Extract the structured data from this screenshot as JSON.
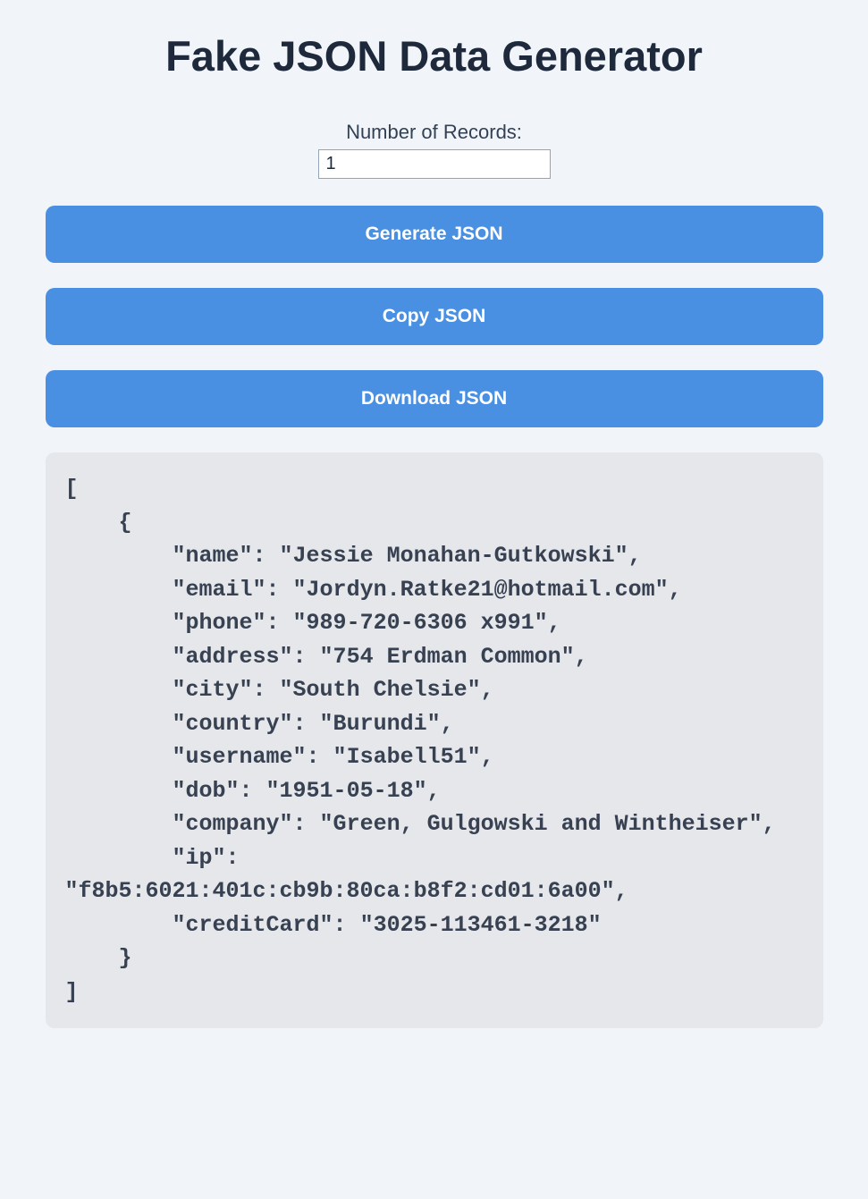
{
  "title": "Fake JSON Data Generator",
  "input": {
    "label": "Number of Records:",
    "value": "1"
  },
  "buttons": {
    "generate": "Generate JSON",
    "copy": "Copy JSON",
    "download": "Download JSON"
  },
  "output": "[\n    {\n        \"name\": \"Jessie Monahan-Gutkowski\",\n        \"email\": \"Jordyn.Ratke21@hotmail.com\",\n        \"phone\": \"989-720-6306 x991\",\n        \"address\": \"754 Erdman Common\",\n        \"city\": \"South Chelsie\",\n        \"country\": \"Burundi\",\n        \"username\": \"Isabell51\",\n        \"dob\": \"1951-05-18\",\n        \"company\": \"Green, Gulgowski and Wintheiser\",\n        \"ip\": \"f8b5:6021:401c:cb9b:80ca:b8f2:cd01:6a00\",\n        \"creditCard\": \"3025-113461-3218\"\n    }\n]"
}
